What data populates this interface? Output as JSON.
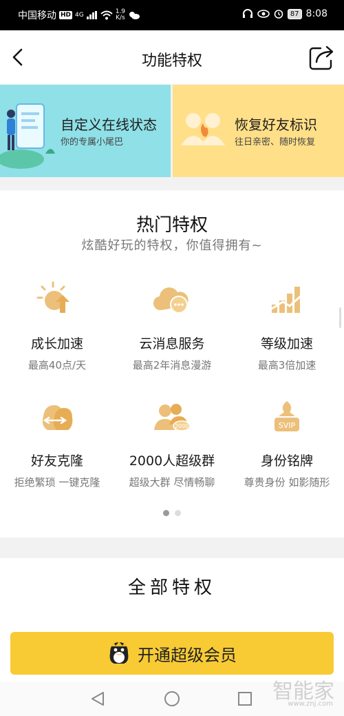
{
  "status_bar": {
    "carrier": "中国移动",
    "hd": "HD",
    "network": "4G",
    "speed_value": "1.9",
    "speed_unit": "K/s",
    "battery": "87",
    "time": "8:08"
  },
  "nav": {
    "title": "功能特权"
  },
  "banners": [
    {
      "title": "自定义在线状态",
      "subtitle": "你的专属小尾巴"
    },
    {
      "title": "恢复好友标识",
      "subtitle": "往日亲密、随时恢复"
    }
  ],
  "hot": {
    "title": "热门特权",
    "subtitle": "炫酷好玩的特权，你值得拥有~",
    "features": [
      {
        "name": "成长加速",
        "desc": "最高40点/天",
        "icon": "sun-arrow-icon"
      },
      {
        "name": "云消息服务",
        "desc": "最高2年消息漫游",
        "icon": "cloud-message-icon"
      },
      {
        "name": "等级加速",
        "desc": "最高3倍加速",
        "icon": "bar-chart-icon"
      },
      {
        "name": "好友克隆",
        "desc": "拒绝繁琐 一键克隆",
        "icon": "penguin-clone-icon"
      },
      {
        "name": "2000人超级群",
        "desc": "超级大群 尽情畅聊",
        "icon": "group-2000-icon"
      },
      {
        "name": "身份铭牌",
        "desc": "尊贵身份 如影随形",
        "icon": "svip-badge-icon"
      }
    ],
    "svip_label": "SVIP",
    "group_badge": "2000",
    "page_count": 2,
    "active_page": 1
  },
  "all": {
    "title": "全部特权"
  },
  "cta": {
    "label": "开通超级会员"
  },
  "watermark": {
    "text": "智能家",
    "url": "www.znj.com"
  },
  "colors": {
    "accent": "#f8cb35",
    "icon_gold": "#ecc07a",
    "banner_left": "#8fe0e7",
    "banner_right": "#ffdf88"
  }
}
